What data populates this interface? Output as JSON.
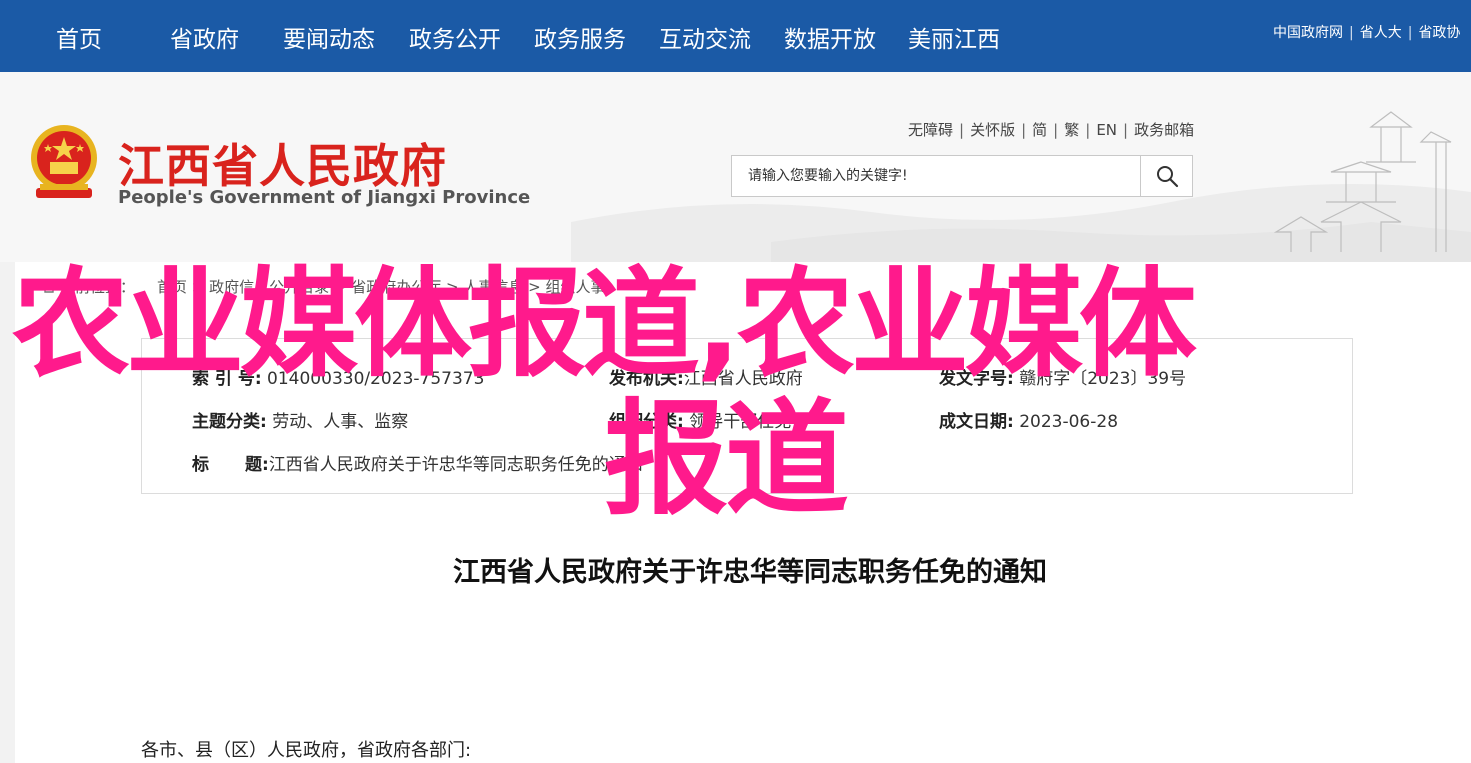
{
  "nav": {
    "items": [
      "首页",
      "省政府",
      "要闻动态",
      "政务公开",
      "政务服务",
      "互动交流",
      "数据开放",
      "美丽江西"
    ],
    "links": [
      "中国政府网",
      "省人大",
      "省政协"
    ]
  },
  "header": {
    "title": "江西省人民政府",
    "subtitle": "People's Government of Jiangxi Province",
    "util_links": [
      "无障碍",
      "关怀版",
      "简",
      "繁",
      "EN",
      "政务邮箱"
    ],
    "search_placeholder": "请输入您要输入的关键字!"
  },
  "breadcrumb": {
    "label": "当前位置：",
    "items": [
      "首页",
      "政府信息公开目录",
      "省政府办公厅",
      "人事信息",
      "组织人事"
    ]
  },
  "meta": {
    "index_label": "索 引 号:",
    "index_value": "014000330/2023-757373",
    "publisher_label": "发布机关:",
    "publisher_value": "江西省人民政府",
    "doc_no_label": "发文字号:",
    "doc_no_value": "赣府字〔2023〕39号",
    "topic_label": "主题分类:",
    "topic_value": "劳动、人事、监察",
    "genre_label": "组配分类:",
    "genre_value": "领导干部任免",
    "date_label": "成文日期:",
    "date_value": "2023-06-28",
    "title_label1": "标",
    "title_label2": "题:",
    "title_value": "江西省人民政府关于许忠华等同志职务任免的通知"
  },
  "document": {
    "title": "江西省人民政府关于许忠华等同志职务任免的通知",
    "salutation": "各市、县（区）人民政府，省政府各部门:"
  },
  "overlay": {
    "line1": "农业媒体报道,农业媒体",
    "line2": "报道"
  },
  "colors": {
    "nav_bg": "#1b5aa6",
    "title_red": "#d9231d",
    "overlay_pink": "#ff1a8c"
  }
}
